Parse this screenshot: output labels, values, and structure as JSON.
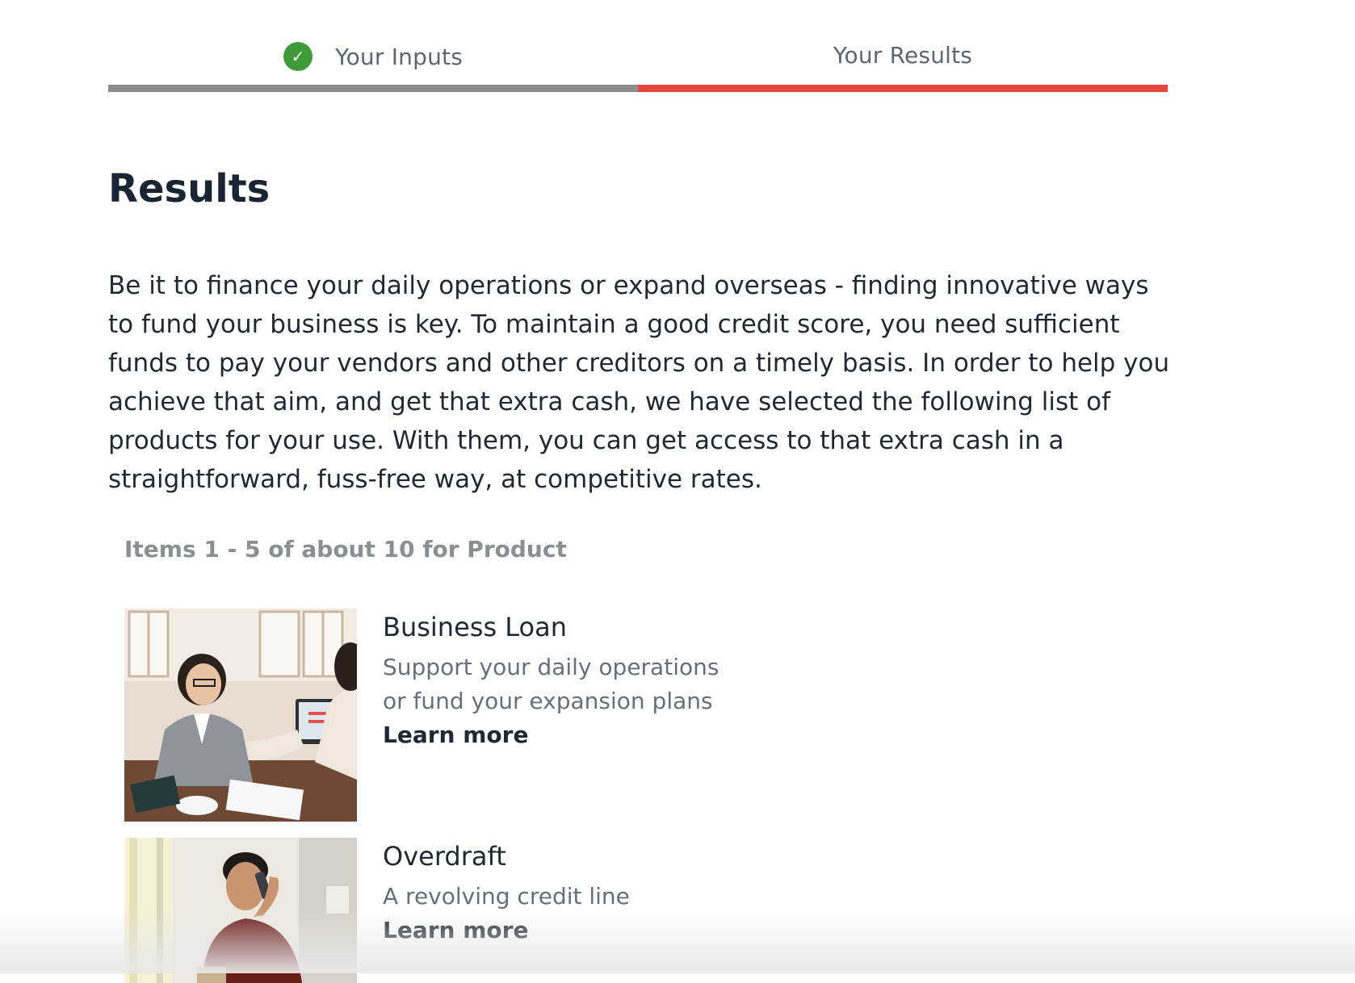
{
  "stepper": {
    "steps": [
      {
        "label": "Your Inputs",
        "completed": true
      },
      {
        "label": "Your Results",
        "completed": false
      }
    ],
    "check_glyph": "✓",
    "colors": {
      "completed_bar": "#8c8c8c",
      "active_bar": "#e8453c",
      "check": "#3f9b3a"
    }
  },
  "main": {
    "title": "Results",
    "intro": "Be it to finance your daily operations or expand overseas - finding innovative ways to fund your business is key. To maintain a good credit score, you need sufficient funds to pay your vendors and other creditors on a timely basis. In order to help you achieve that aim, and get that extra cash, we have selected the following list of products for your use. With them, you can get access to that extra cash in a straightforward, fuss-free way, at competitive rates.",
    "items_count": "Items 1 - 5 of about 10 for Product"
  },
  "products": [
    {
      "name": "Business Loan",
      "description": "Support your daily operations or fund your expansion plans",
      "link_label": "Learn more"
    },
    {
      "name": "Overdraft",
      "description": "A revolving credit line",
      "link_label": "Learn more"
    }
  ]
}
